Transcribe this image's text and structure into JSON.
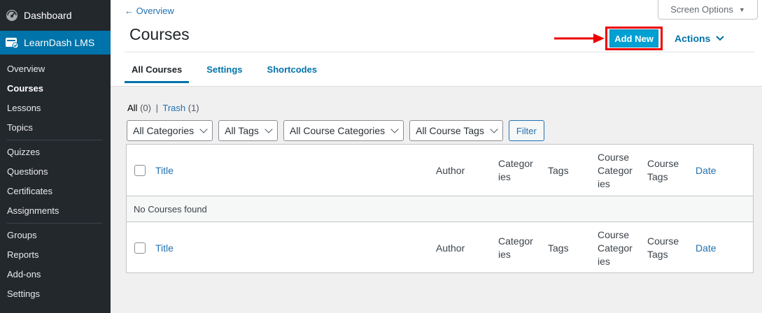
{
  "sidebar": {
    "dashboard": "Dashboard",
    "learndash": "LearnDash LMS",
    "items": [
      {
        "label": "Overview"
      },
      {
        "label": "Courses"
      },
      {
        "label": "Lessons"
      },
      {
        "label": "Topics"
      },
      {
        "label": "Quizzes"
      },
      {
        "label": "Questions"
      },
      {
        "label": "Certificates"
      },
      {
        "label": "Assignments"
      },
      {
        "label": "Groups"
      },
      {
        "label": "Reports"
      },
      {
        "label": "Add-ons"
      },
      {
        "label": "Settings"
      }
    ]
  },
  "header": {
    "back": "← Overview",
    "title": "Courses",
    "screen_options": "Screen Options",
    "add_new": "Add New",
    "actions": "Actions",
    "tabs": [
      {
        "label": "All Courses"
      },
      {
        "label": "Settings"
      },
      {
        "label": "Shortcodes"
      }
    ]
  },
  "status": {
    "all": "All",
    "all_count": "(0)",
    "sep": "|",
    "trash": "Trash",
    "trash_count": "(1)"
  },
  "filters": {
    "categories": "All Categories",
    "tags": "All Tags",
    "course_categories": "All Course Categories",
    "course_tags": "All Course Tags",
    "filter_button": "Filter"
  },
  "table": {
    "columns": {
      "title": "Title",
      "author": "Author",
      "categories_1": "Categor",
      "categories_2": "ies",
      "tags": "Tags",
      "course_categories_1": "Course",
      "course_categories_2": "Categor",
      "course_categories_3": "ies",
      "course_tags_1": "Course",
      "course_tags_2": "Tags",
      "date": "Date"
    },
    "empty": "No Courses found"
  },
  "colors": {
    "sidebar_bg": "#23282d",
    "active_menu": "#0073aa",
    "add_new_bg": "#00a0d2",
    "highlight": "#e00000"
  }
}
